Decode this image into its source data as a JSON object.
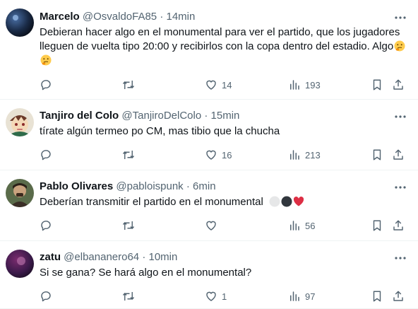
{
  "tweets": [
    {
      "name": "Marcelo",
      "handle": "@OsvaldoFA85",
      "sep": "·",
      "time": "14min",
      "text": "Debieran hacer algo en el monumental para ver el partido, que los jugadores lleguen de vuelta tipo 20:00 y recibirlos con la copa dentro del estadio. Algo",
      "emojis": [
        "thinking-face",
        "thinking-face"
      ],
      "likes": "14",
      "views": "193"
    },
    {
      "name": "Tanjiro del Colo",
      "handle": "@TanjiroDelColo",
      "sep": "·",
      "time": "15min",
      "text": "tírate algún termeo po CM, mas tibio que la chucha",
      "likes": "16",
      "views": "213"
    },
    {
      "name": "Pablo Olivares",
      "handle": "@pabloispunk",
      "sep": "·",
      "time": "6min",
      "text": "Deberían transmitir el partido en el monumental",
      "emojis": [
        "white-circle",
        "black-circle",
        "red-heart"
      ],
      "likes": "",
      "views": "56"
    },
    {
      "name": "zatu",
      "handle": "@elbananero64",
      "sep": "·",
      "time": "10min",
      "text": "Si se gana? Se hará algo en el monumental?",
      "likes": "1",
      "views": "97"
    }
  ],
  "colors": {
    "text": "#0f1419",
    "muted": "#536471",
    "divider": "#eff3f4",
    "heart": "#f91880"
  }
}
